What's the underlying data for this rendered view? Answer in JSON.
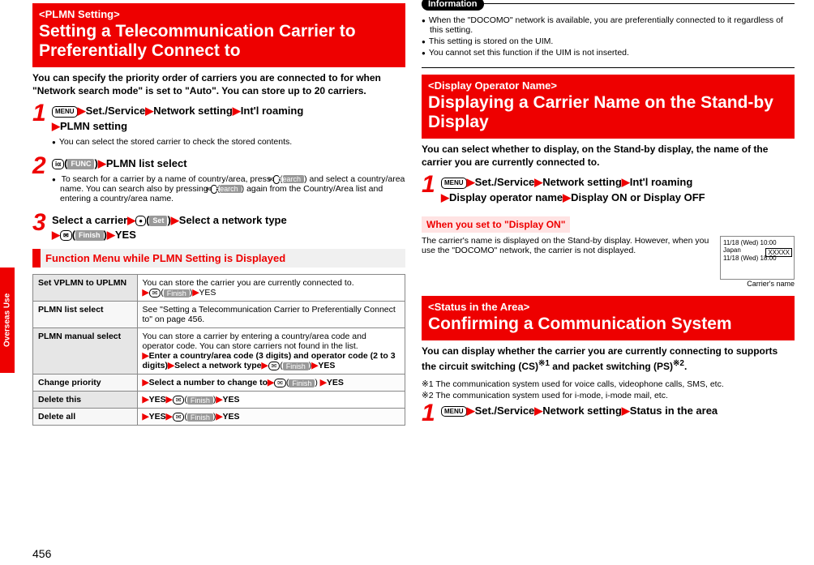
{
  "side_tab": "Overseas Use",
  "page_number": "456",
  "col1": {
    "section1": {
      "tag": "<PLMN Setting>",
      "title": "Setting a Telecommunication Carrier to Preferentially Connect to",
      "intro": "You can specify the priority order of carriers you are connected to for when \"Network search mode\" is set to \"Auto\". You can store up to 20 carriers.",
      "step1": {
        "num": "1",
        "menu_icon": "MENU",
        "p1": "Set./Service",
        "p2": "Network setting",
        "p3": "Int'l roaming",
        "p4": "PLMN setting",
        "note": "You can select the stored carrier to check the stored contents."
      },
      "step2": {
        "num": "2",
        "ir_icon": "iα",
        "func_label": "FUNC",
        "p1": "PLMN list select",
        "note_a": "To search for a carrier by a name of country/area, press ",
        "mail_icon": "✉",
        "search_label": "Search",
        "note_b": " and select a country/area name. You can search also by pressing ",
        "note_c": " again from the Country/Area list and entering a country/area name."
      },
      "step3": {
        "num": "3",
        "p1": "Select a carrier",
        "center_icon": "●",
        "set_label": "Set",
        "p2": "Select a network type",
        "mail_icon": "✉",
        "finish_label": "Finish",
        "p3": "YES"
      }
    },
    "funcmenu": {
      "title": "Function Menu while PLMN Setting is Displayed",
      "rows": [
        {
          "label": "Set VPLMN to UPLMN",
          "text_a": "You can store the carrier you are currently connected to.",
          "icon": "✉",
          "btn": "Finish",
          "text_b": "YES"
        },
        {
          "label": "PLMN list select",
          "text": "See \"Setting a Telecommunication Carrier to Preferentially Connect to\" on page 456."
        },
        {
          "label": "PLMN manual select",
          "text_a": "You can store a carrier by entering a country/area code and operator code. You can store carriers not found in the list.",
          "text_b": "Enter a country/area code (3 digits) and operator code (2 to 3 digits)",
          "text_c": "Select a network type",
          "icon": "✉",
          "btn": "Finish",
          "text_d": "YES"
        },
        {
          "label": "Change priority",
          "text_a": "Select a number to change to",
          "icon": "✉",
          "btn": "Finish",
          "text_b": "YES"
        },
        {
          "label": "Delete this",
          "text_a": "YES",
          "icon": "✉",
          "btn": "Finish",
          "text_b": "YES"
        },
        {
          "label": "Delete all",
          "text_a": "YES",
          "icon": "✉",
          "btn": "Finish",
          "text_b": "YES"
        }
      ]
    }
  },
  "col2": {
    "info": {
      "label": "Information",
      "b1": "When the \"DOCOMO\" network is available, you are preferentially connected to it regardless of this setting.",
      "b2": "This setting is stored on the UIM.",
      "b3": "You cannot set this function if the UIM is not inserted."
    },
    "section2": {
      "tag": "<Display Operator Name>",
      "title": "Displaying a Carrier Name on the Stand-by Display",
      "intro": "You can select whether to display, on the Stand-by display, the name of the carrier you are currently connected to.",
      "step1": {
        "num": "1",
        "menu_icon": "MENU",
        "p1": "Set./Service",
        "p2": "Network setting",
        "p3": "Int'l roaming",
        "p4": "Display operator name",
        "p5": "Display ON or Display OFF"
      },
      "when_title": "When you set to \"Display ON\"",
      "when_body": "The carrier's name is displayed on the Stand-by display. However, when you use the \"DOCOMO\" network, the carrier is not displayed.",
      "standby": {
        "l1": "11/18 (Wed) 10:00",
        "l2": "Japan",
        "l3": "11/18 (Wed) 18:00",
        "box": "XXXXX"
      },
      "carrier_note": "Carrier's name"
    },
    "section3": {
      "tag": "<Status in the Area>",
      "title": "Confirming a Communication System",
      "intro_a": "You can display whether the carrier you are currently connecting to supports the circuit switching (CS)",
      "sup1": "※1",
      "intro_b": " and packet switching (PS)",
      "sup2": "※2",
      "intro_c": ".",
      "fn1": "※1 The communication system used for voice calls, videophone calls, SMS, etc.",
      "fn2": "※2 The communication system used for i-mode, i-mode mail, etc.",
      "step1": {
        "num": "1",
        "menu_icon": "MENU",
        "p1": "Set./Service",
        "p2": "Network setting",
        "p3": "Status in the area"
      }
    }
  }
}
